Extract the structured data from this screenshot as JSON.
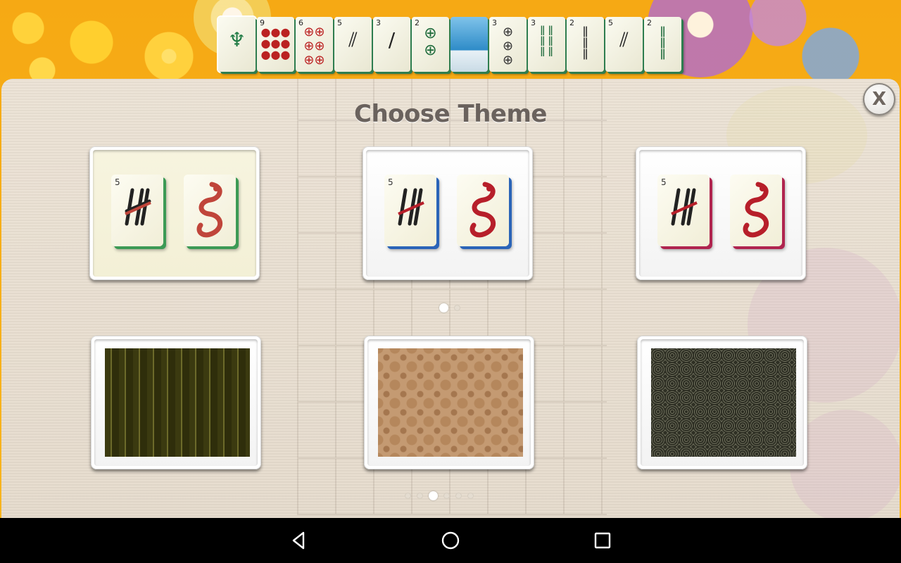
{
  "modal": {
    "title": "Choose Theme",
    "close_label": "X"
  },
  "tile_themes": {
    "active_page": 1,
    "page_count": 2,
    "options": [
      {
        "name": "cream-green",
        "number": "5",
        "side_color": "#3c9a55",
        "dragon_color": "#c0453a",
        "face": "#f7f4df"
      },
      {
        "name": "white-blue",
        "number": "5",
        "side_color": "#2a64b8",
        "dragon_color": "#b71f2a",
        "face": "#ffffff"
      },
      {
        "name": "white-magenta",
        "number": "5",
        "side_color": "#b0244f",
        "dragon_color": "#b71f2a",
        "face": "#ffffff"
      }
    ]
  },
  "background_themes": {
    "active_page": 3,
    "page_count": 6,
    "options": [
      {
        "name": "dark-olive-stripes",
        "color": "#3b3a10"
      },
      {
        "name": "tan-damask",
        "color": "#c49a72"
      },
      {
        "name": "charcoal-circles",
        "color": "#3a3b2e"
      }
    ]
  },
  "board_tiles": [
    "dragon",
    "9",
    "6",
    "5",
    "3",
    "2",
    "photo",
    "3",
    "3",
    "2",
    "5",
    "2"
  ],
  "android_nav": {
    "back": "back-icon",
    "home": "home-icon",
    "recents": "recents-icon"
  },
  "colors": {
    "background_orange": "#f7b518",
    "title_gray": "#6a625d"
  }
}
